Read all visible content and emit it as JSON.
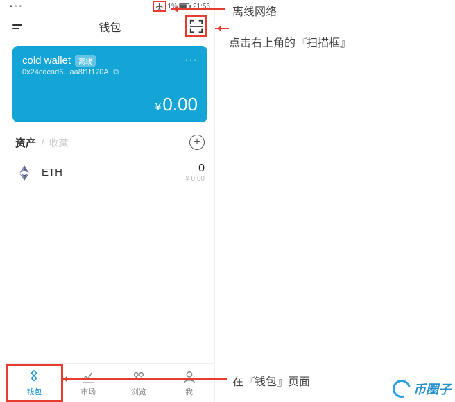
{
  "status": {
    "battery_pct": "1%",
    "time": "21:56"
  },
  "header": {
    "title": "钱包"
  },
  "wallet_card": {
    "name": "cold wallet",
    "badge": "离线",
    "address": "0x24cdcad6...aa8f1f170A",
    "currency": "¥",
    "balance": "0.00"
  },
  "assets": {
    "tab_assets": "资产",
    "tab_fav": "收藏",
    "items": [
      {
        "symbol": "ETH",
        "amount": "0",
        "fiat": "¥ 0.00"
      }
    ]
  },
  "tabbar": {
    "wallet": "钱包",
    "market": "市场",
    "browse": "浏览",
    "me": "我"
  },
  "annotations": {
    "offline": "离线网络",
    "scan": "点击右上角的『扫描框』",
    "wallet_page": "在『钱包』页面"
  },
  "watermark": "币圈子"
}
